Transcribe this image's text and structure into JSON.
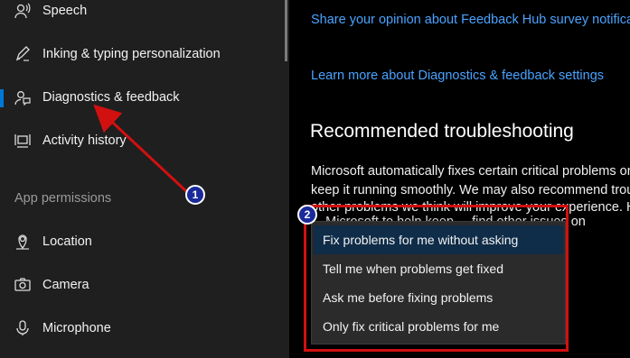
{
  "sidebar": {
    "items": [
      {
        "label": "Speech",
        "icon": "speech-icon",
        "selected": false
      },
      {
        "label": "Inking & typing personalization",
        "icon": "pen-icon",
        "selected": false
      },
      {
        "label": "Diagnostics & feedback",
        "icon": "diagnostics-feedback-icon",
        "selected": true
      },
      {
        "label": "Activity history",
        "icon": "activity-history-icon",
        "selected": false
      }
    ],
    "section_heading": "App permissions",
    "permissions": [
      {
        "label": "Location",
        "icon": "location-icon"
      },
      {
        "label": "Camera",
        "icon": "camera-icon"
      },
      {
        "label": "Microphone",
        "icon": "microphone-icon"
      }
    ]
  },
  "main": {
    "link_survey": "Share your opinion about Feedback Hub survey notificati",
    "link_learn_more": "Learn more about Diagnostics & feedback settings",
    "section_title": "Recommended troubleshooting",
    "body_lines": [
      "Microsoft automatically fixes certain critical problems on y",
      "keep it running smoothly. We may also recommend troub",
      "other problems we think will improve your experience. Ho",
      "  ...  Microsoft to help keep ... find other issues on"
    ]
  },
  "dropdown": {
    "options": [
      "Fix problems for me without asking",
      "Tell me when problems get fixed",
      "Ask me before fixing problems",
      "Only fix critical problems for me"
    ],
    "highlighted_index": 0
  },
  "annotations": {
    "badge_1": "1",
    "badge_2": "2"
  },
  "colors": {
    "accent": "#0078d7",
    "link": "#4aa3ff",
    "annotation_red": "#d11010",
    "badge_blue": "#1a2a9a",
    "highlight": "#0f2c48"
  }
}
